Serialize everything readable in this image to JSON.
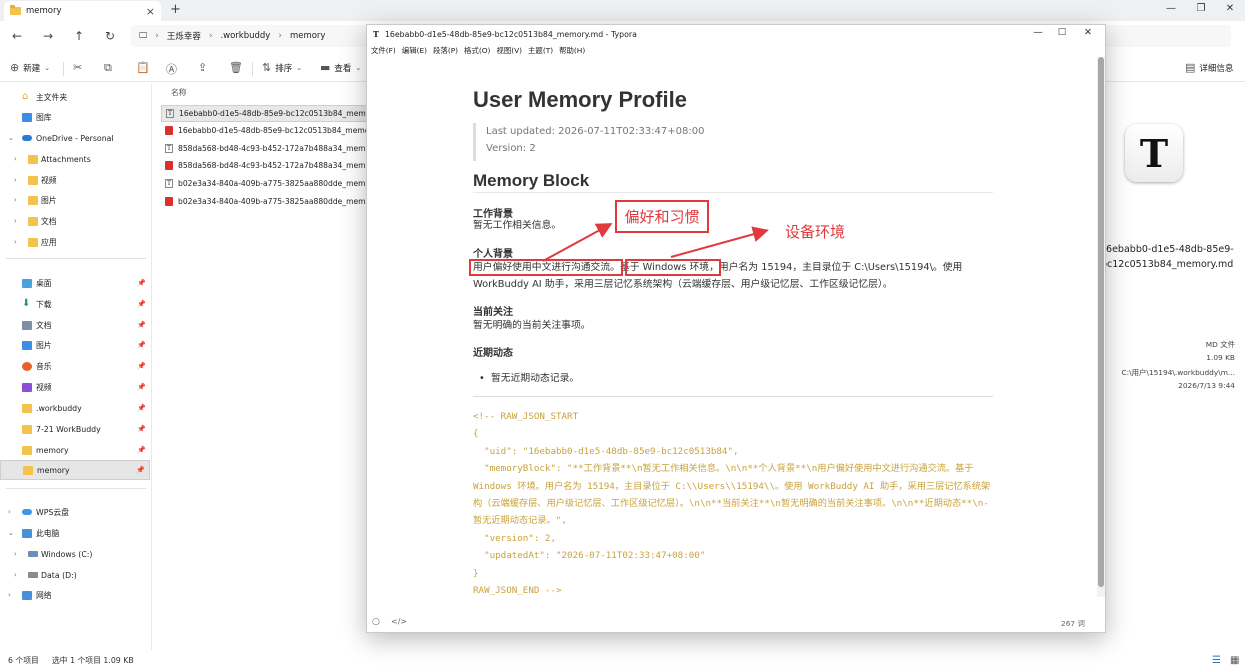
{
  "explorer": {
    "tab_title": "memory",
    "breadcrumb": [
      "王烁幸蓉",
      ".workbuddy",
      "memory"
    ],
    "commands": {
      "new": "新建",
      "sort": "排序",
      "view": "查看",
      "details": "详细信息"
    },
    "sidebar": {
      "home": "主文件夹",
      "gallery": "图库",
      "onedrive": "OneDrive - Personal",
      "onedrive_children": [
        "Attachments",
        "视频",
        "图片",
        "文档",
        "应用"
      ],
      "quick": [
        "桌面",
        "下载",
        "文档",
        "图片",
        "音乐",
        "视频",
        ".workbuddy",
        "7-21 WorkBuddy",
        "memory",
        "memory"
      ],
      "wps": "WPS云盘",
      "thispc": "此电脑",
      "drives": [
        "Windows (C:)",
        "Data (D:)"
      ],
      "network": "网络"
    },
    "column_name": "名称",
    "files": [
      {
        "name": "16ebabb0-d1e5-48db-85e9-bc12c0513b84_memory.md",
        "type": "typora"
      },
      {
        "name": "16ebabb0-d1e5-48db-85e9-bc12c0513b84_memory.pdf",
        "type": "pdf"
      },
      {
        "name": "858da568-bd48-4c93-b452-172a7b488a34_memory.md",
        "type": "typora"
      },
      {
        "name": "858da568-bd48-4c93-b452-172a7b488a34_memory.pdf",
        "type": "pdf"
      },
      {
        "name": "b02e3a34-840a-409b-a775-3825aa880dde_memory.md",
        "type": "typora"
      },
      {
        "name": "b02e3a34-840a-409b-a775-3825aa880dde_memory.pdf",
        "type": "pdf"
      }
    ],
    "status": {
      "count": "6 个项目",
      "selected": "选中 1 个项目  1.09 KB"
    },
    "details_panel": {
      "filename_line1": "16ebabb0-d1e5-48db-85e9-",
      "filename_line2": "bc12c0513b84_memory.md",
      "type": "MD 文件",
      "size": "1.09 KB",
      "path": "C:\\用户\\15194\\.workbuddy\\m...",
      "date": "2026/7/13 9:44"
    }
  },
  "typora": {
    "title": "16ebabb0-d1e5-48db-85e9-bc12c0513b84_memory.md - Typora",
    "menu": [
      "文件(F)",
      "编辑(E)",
      "段落(P)",
      "格式(O)",
      "视图(V)",
      "主题(T)",
      "帮助(H)"
    ],
    "doc": {
      "h1": "User Memory Profile",
      "last_updated": "Last updated: 2026-07-11T02:33:47+08:00",
      "version": "Version: 2",
      "h2": "Memory Block",
      "sec_work_title": "工作背景",
      "sec_work_text": "暂无工作相关信息。",
      "sec_personal_title": "个人背景",
      "sec_personal_text_a": "用户偏好使用中文进行沟通交流。",
      "sec_personal_text_b": "基于 Windows 环境",
      "sec_personal_text_c": "，用户名为 15194，主目录位于 C:\\Users\\15194\\。使用",
      "sec_personal_text_d": "WorkBuddy AI 助手，采用三层记忆系统架构（云端缓存层、用户级记忆层、工作区级记忆层）。",
      "sec_focus_title": "当前关注",
      "sec_focus_text": "暂无明确的当前关注事项。",
      "sec_recent_title": "近期动态",
      "sec_recent_bullet": "暂无近期动态记录。",
      "code": "<!-- RAW_JSON_START\n{\n  \"uid\": \"16ebabb0-d1e5-48db-85e9-bc12c0513b84\",\n  \"memoryBlock\": \"**工作背景**\\n暂无工作相关信息。\\n\\n**个人背景**\\n用户偏好使用中文进行沟通交流。基于 Windows 环境。用户名为 15194，主目录位于 C:\\\\Users\\\\15194\\\\。使用 WorkBuddy AI 助手，采用三层记忆系统架构（云端缓存层、用户级记忆层、工作区级记忆层）。\\n\\n**当前关注**\\n暂无明确的当前关注事项。\\n\\n**近期动态**\\n- 暂无近期动态记录。\",\n  \"version\": 2,\n  \"updatedAt\": \"2026-07-11T02:33:47+08:00\"\n}\nRAW_JSON_END -->"
    },
    "word_count": "267 词"
  },
  "annotations": {
    "label_preference": "偏好和习惯",
    "label_env": "设备环境",
    "color": "#e0393e"
  }
}
